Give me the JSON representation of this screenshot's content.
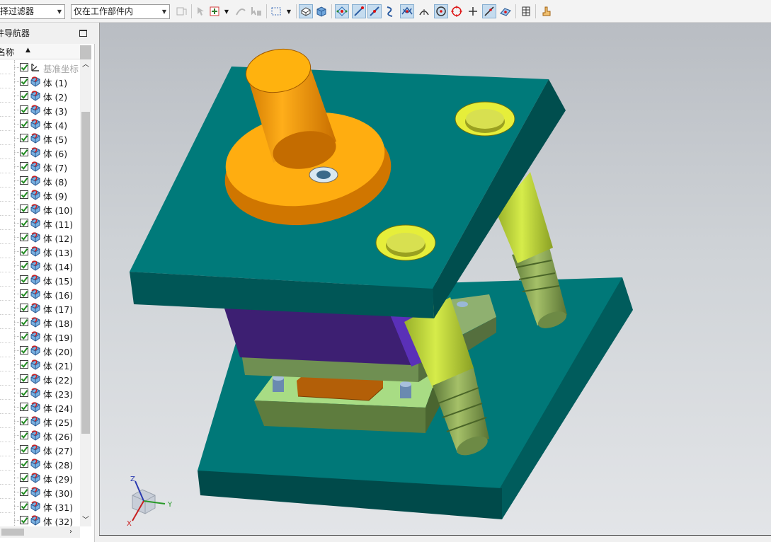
{
  "toolbar": {
    "filter_combo": "择过滤器",
    "scope_combo": "仅在工作部件内"
  },
  "navigator": {
    "title": "件导航器",
    "column_name": "名称",
    "items": [
      {
        "label": "基准坐标",
        "dim": true,
        "icon": "datum-csys-icon"
      },
      {
        "label": "体 (1)"
      },
      {
        "label": "体 (2)"
      },
      {
        "label": "体 (3)"
      },
      {
        "label": "体 (4)"
      },
      {
        "label": "体 (5)"
      },
      {
        "label": "体 (6)"
      },
      {
        "label": "体 (7)"
      },
      {
        "label": "体 (8)"
      },
      {
        "label": "体 (9)"
      },
      {
        "label": "体 (10)"
      },
      {
        "label": "体 (11)"
      },
      {
        "label": "体 (12)"
      },
      {
        "label": "体 (13)"
      },
      {
        "label": "体 (14)"
      },
      {
        "label": "体 (15)"
      },
      {
        "label": "体 (16)"
      },
      {
        "label": "体 (17)"
      },
      {
        "label": "体 (18)"
      },
      {
        "label": "体 (19)"
      },
      {
        "label": "体 (20)"
      },
      {
        "label": "体 (21)"
      },
      {
        "label": "体 (22)"
      },
      {
        "label": "体 (23)"
      },
      {
        "label": "体 (24)"
      },
      {
        "label": "体 (25)"
      },
      {
        "label": "体 (26)"
      },
      {
        "label": "体 (27)"
      },
      {
        "label": "体 (28)"
      },
      {
        "label": "体 (29)"
      },
      {
        "label": "体 (30)"
      },
      {
        "label": "体 (31)"
      },
      {
        "label": "体 (32)"
      }
    ]
  },
  "viewport": {
    "triad": {
      "x": "X",
      "y": "Y",
      "z": "Z"
    },
    "colors": {
      "plate": "#007a7a",
      "plate_dark": "#004e4e",
      "handle": "#f5a300",
      "guide_post": "#c8e03a",
      "punch_body": "#3a1f6e",
      "die_insert": "#e07a10",
      "stripper": "#8ab06a",
      "bushing": "#e6ee3a"
    }
  }
}
